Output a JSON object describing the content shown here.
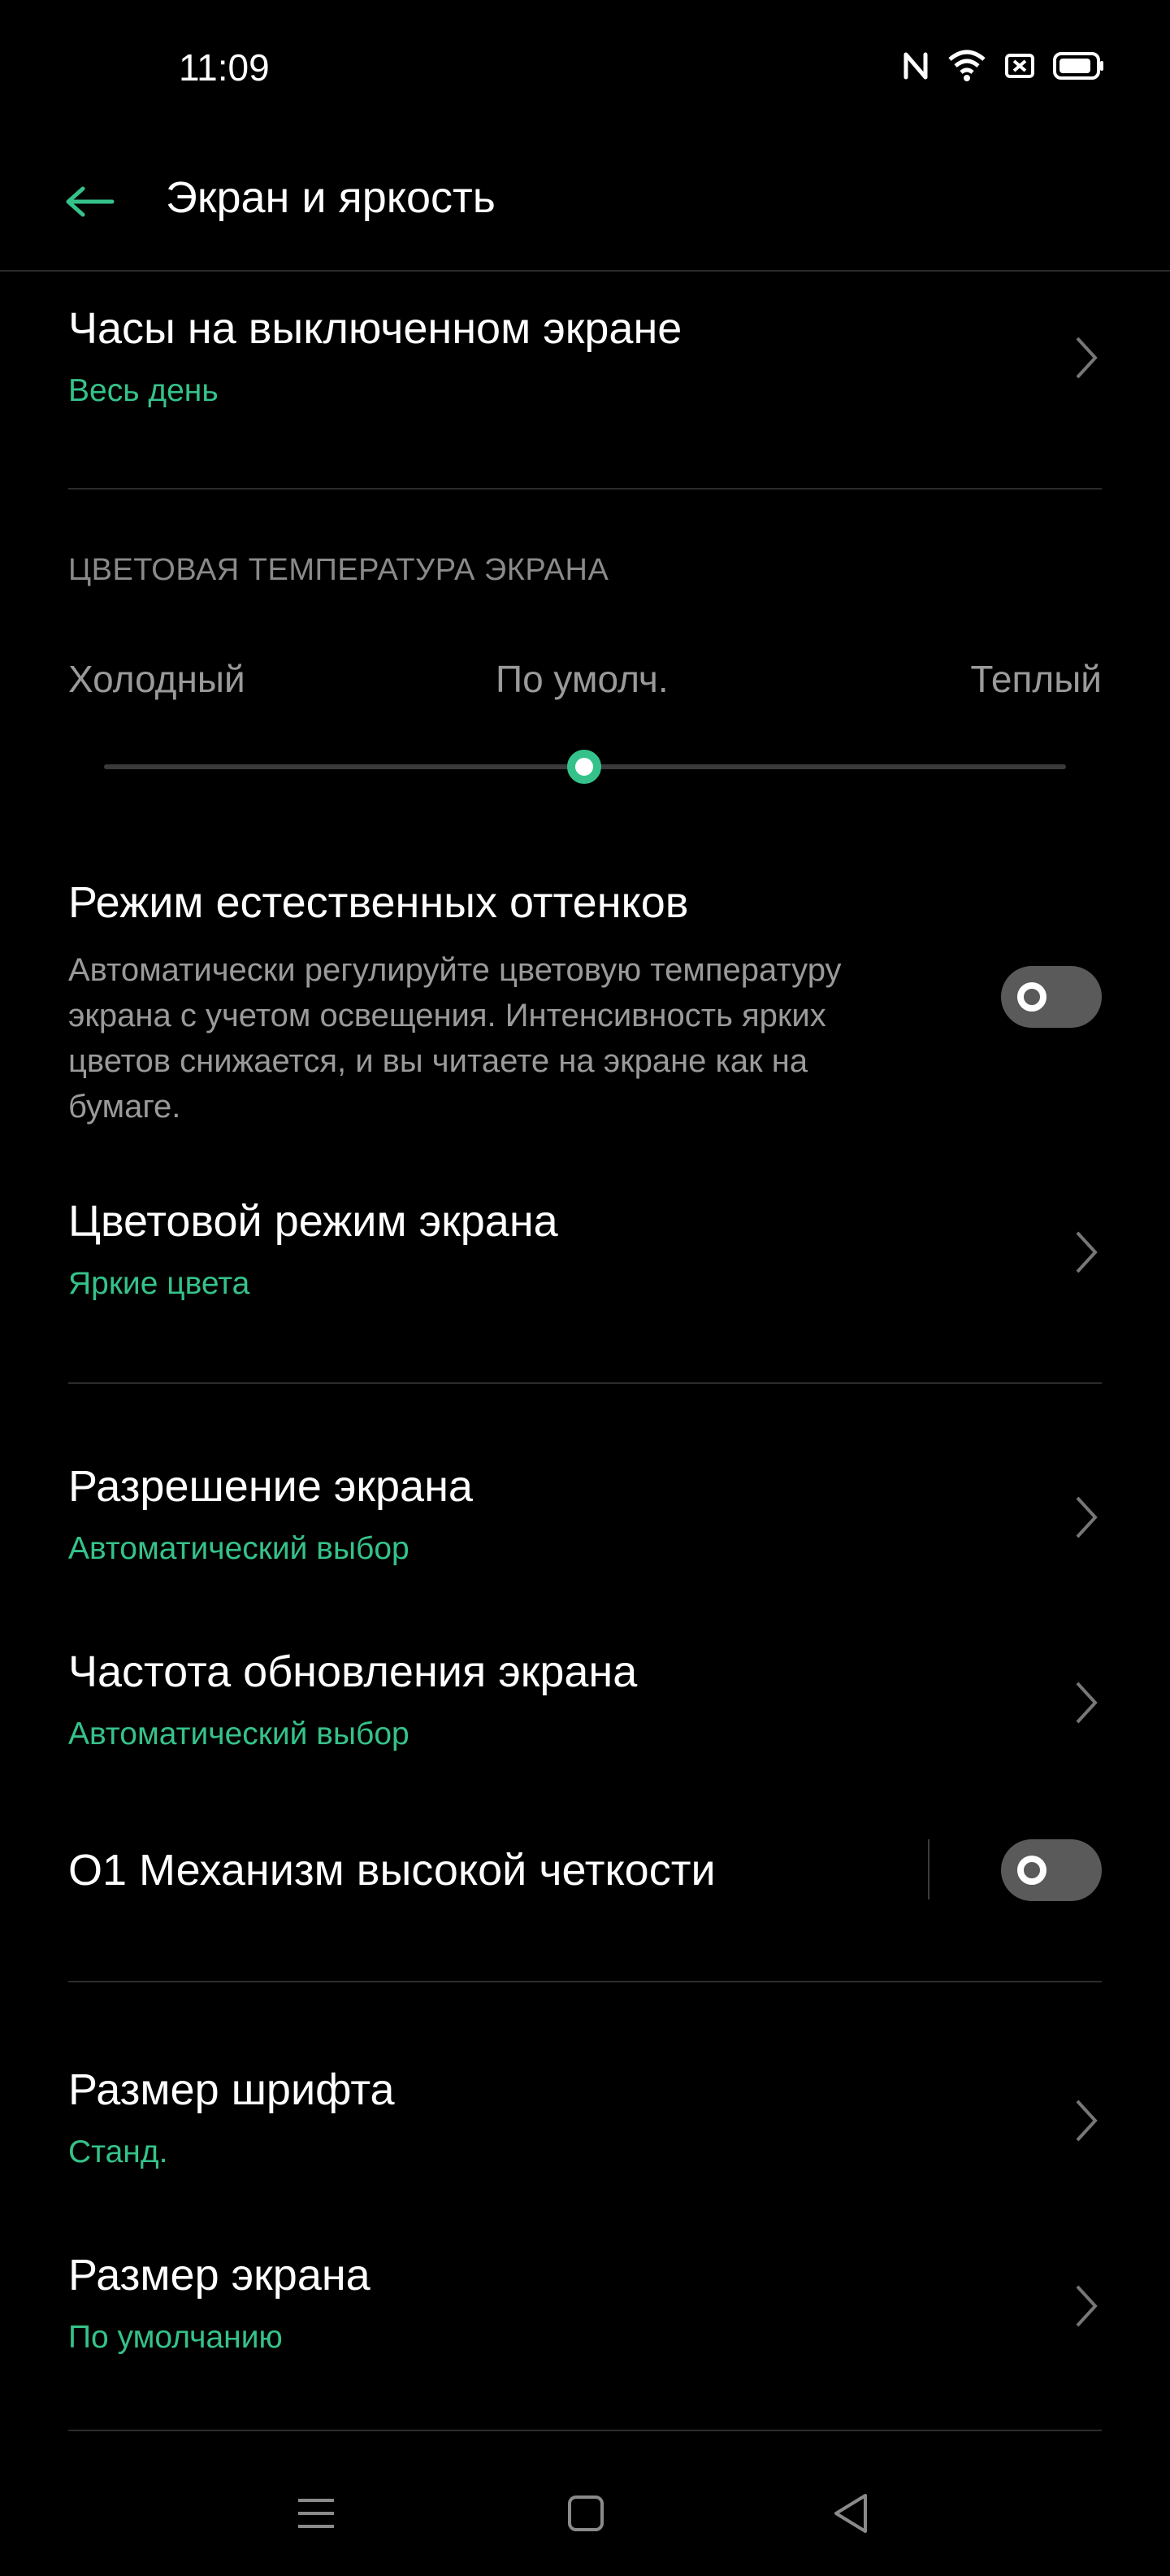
{
  "status_bar": {
    "time": "11:09",
    "icons": [
      "nfc-icon",
      "wifi-icon",
      "notification-icon",
      "battery-icon"
    ]
  },
  "header": {
    "title": "Экран и яркость",
    "back_icon": "arrow-left-icon"
  },
  "items": {
    "aod": {
      "title": "Часы на выключенном экране",
      "value": "Весь день"
    },
    "temperature": {
      "section_title": "ЦВЕТОВАЯ ТЕМПЕРАТУРА ЭКРАНА",
      "label_cold": "Холодный",
      "label_default": "По умолч.",
      "label_warm": "Теплый",
      "value_fraction": 0.5
    },
    "natural_mode": {
      "title": "Режим естественных оттенков",
      "description": "Автоматически регулируйте цветовую температуру экрана с учетом освещения. Интенсивность ярких цветов снижается, и вы читаете на экране как на бумаге.",
      "enabled": false
    },
    "color_mode": {
      "title": "Цветовой режим экрана",
      "value": "Яркие цвета"
    },
    "resolution": {
      "title": "Разрешение экрана",
      "value": "Автоматический выбор"
    },
    "refresh_rate": {
      "title": "Частота обновления экрана",
      "value": "Автоматический выбор"
    },
    "o1_engine": {
      "title": "O1 Механизм высокой четкости",
      "enabled": false
    },
    "font_size": {
      "title": "Размер шрифта",
      "value": "Станд."
    },
    "display_size": {
      "title": "Размер экрана",
      "value": "По умолчанию"
    }
  },
  "nav_bar": {
    "buttons": [
      "menu-icon",
      "home-icon",
      "back-icon"
    ]
  },
  "colors": {
    "accent": "#35c28a",
    "background": "#000000",
    "text_primary": "#ffffff",
    "text_secondary": "#9a9a9a",
    "divider": "#2c2c2c"
  }
}
